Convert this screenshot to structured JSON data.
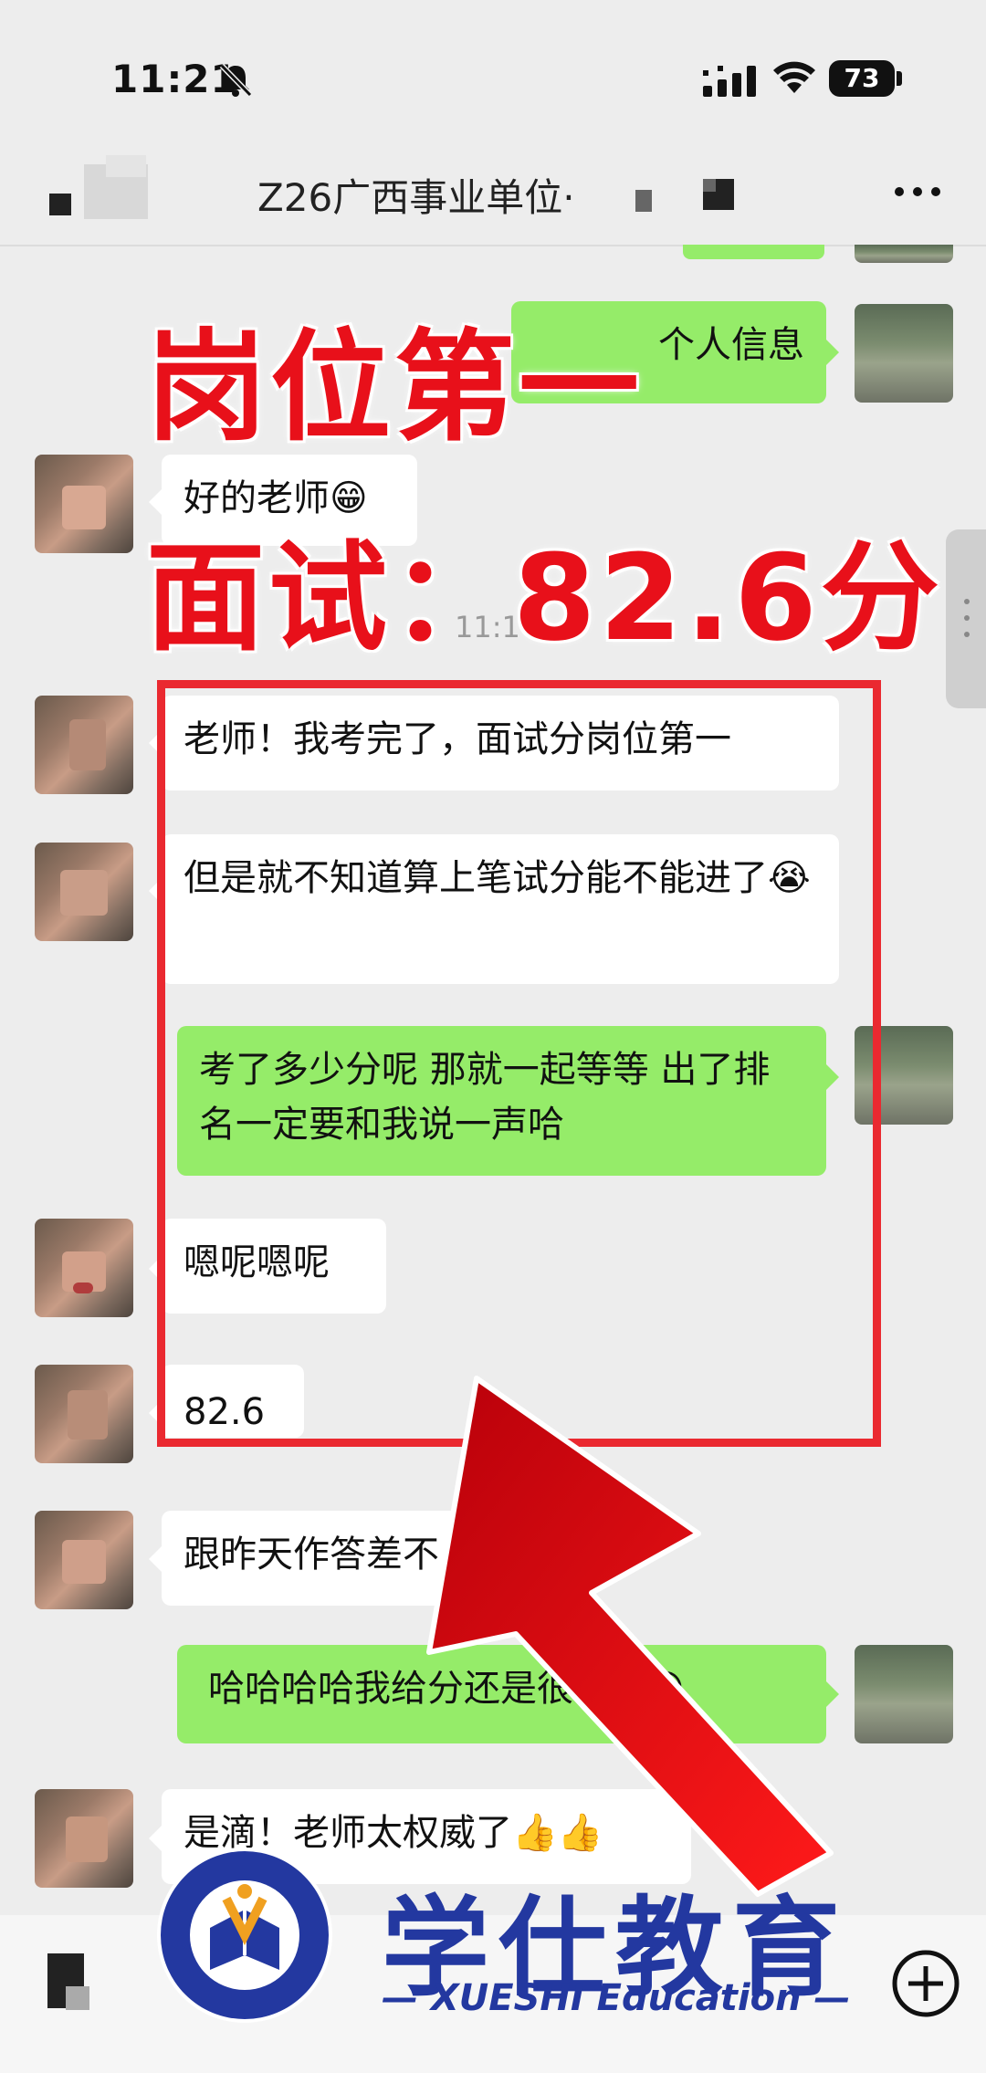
{
  "status_bar": {
    "time": "11:21",
    "battery": "73"
  },
  "header": {
    "title": "Z26广西事业单位·"
  },
  "overlay": {
    "line1": "岗位第一",
    "line2": "面试：82.6分"
  },
  "messages": [
    {
      "side": "right",
      "text": "个人信息"
    },
    {
      "side": "left",
      "text": "好的老师😁"
    },
    {
      "side": "center",
      "text": "11:1"
    },
    {
      "side": "left",
      "text": "老师！我考完了，面试分岗位第一"
    },
    {
      "side": "left",
      "text": "但是就不知道算上笔试分能不能进了😭"
    },
    {
      "side": "right",
      "text": "考了多少分呢 那就一起等等 出了排名一定要和我说一声哈"
    },
    {
      "side": "left",
      "text": "嗯呢嗯呢"
    },
    {
      "side": "left",
      "text": "82.6"
    },
    {
      "side": "left",
      "text": "跟昨天作答差不"
    },
    {
      "side": "right",
      "text": "哈哈哈哈我给分还是很…的😁"
    },
    {
      "side": "left",
      "text": "是滴！老师太权威了👍👍"
    }
  ],
  "brand": {
    "name": "学仕教育",
    "sub": "— XUESHI Education —",
    "seal_top": "XUESHI EDUCATION",
    "seal_bottom": "学 仕 教 育"
  },
  "colors": {
    "overlay_red": "#e8101a",
    "bubble_green": "#95ec69",
    "brand_blue": "#2338a0",
    "box_red": "#ea2930"
  },
  "icons": [
    "bell-off-icon",
    "signal-icon",
    "wifi-icon",
    "battery-icon",
    "back-icon",
    "more-icon",
    "plus-icon",
    "arrow-up-icon"
  ]
}
